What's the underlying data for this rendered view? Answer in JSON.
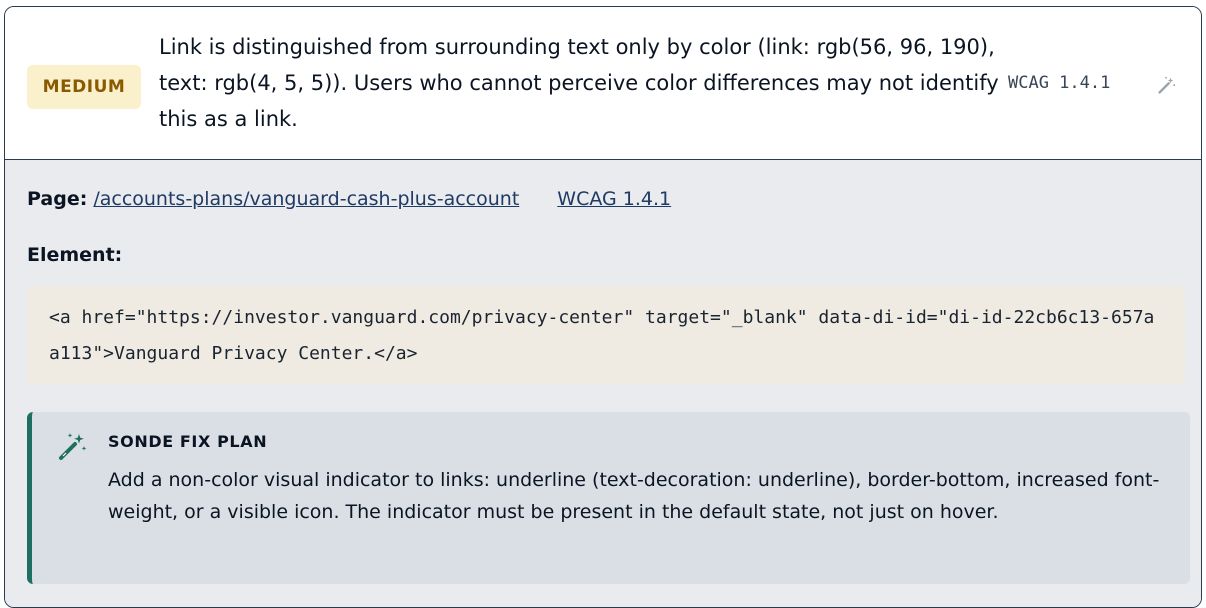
{
  "issue": {
    "severity": "MEDIUM",
    "message": "Link is distinguished from surrounding text only by color (link: rgb(56, 96, 190), text: rgb(4, 5, 5)). Users who cannot perceive color differences may not identify this as a link.",
    "wcag_tag": "WCAG 1.4.1",
    "fix_icon": "magic-wand-icon"
  },
  "details": {
    "page_label": "Page:",
    "page_url": "/accounts-plans/vanguard-cash-plus-account",
    "wcag_link": "WCAG 1.4.1",
    "element_label": "Element:",
    "element_code": "<a href=\"https://investor.vanguard.com/privacy-center\" target=\"_blank\" data-di-id=\"di-id-22cb6c13-657aa113\">Vanguard Privacy Center.</a>"
  },
  "fix_plan": {
    "icon": "magic-wand-icon",
    "title": "SONDE FIX PLAN",
    "body": "Add a non-color visual indicator to links: underline (text-decoration: underline), border-bottom, increased font-weight, or a visible icon. The indicator must be present in the default state, not just on hover."
  },
  "colors": {
    "severity_bg": "#fbf0cc",
    "severity_text": "#8a5a00",
    "fix_accent": "#1f6e62",
    "link": "#1f3a63"
  }
}
